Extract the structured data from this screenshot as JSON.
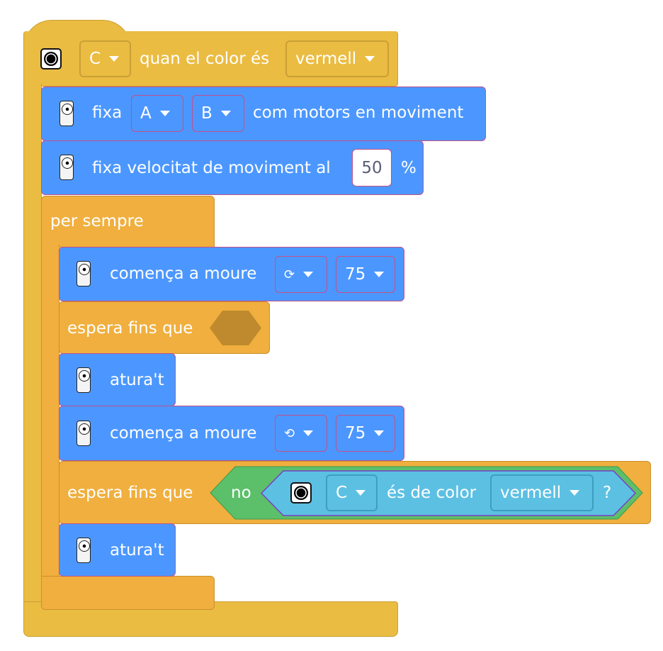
{
  "hat": {
    "port": "C",
    "label": "quan el color és",
    "color": "vermell"
  },
  "blocks": {
    "set_motors": {
      "prefix": "fixa",
      "port1": "A",
      "port2": "B",
      "suffix": "com motors en moviment"
    },
    "set_speed": {
      "label": "fixa velocitat de moviment al",
      "value": "50",
      "unit": "%"
    },
    "forever": {
      "label": "per sempre"
    },
    "start1": {
      "label": "comença a moure",
      "direction_icon": "clockwise-icon",
      "speed": "75"
    },
    "wait1": {
      "label": "espera fins que"
    },
    "stop1": {
      "label": "atura't"
    },
    "start2": {
      "label": "comença a moure",
      "direction_icon": "counterclockwise-icon",
      "speed": "75"
    },
    "wait2": {
      "label": "espera fins que",
      "not": "no",
      "sensor_port": "C",
      "is_color": "és de color",
      "color": "vermell",
      "question": "?"
    },
    "stop2": {
      "label": "atura't"
    }
  },
  "colors": {
    "events": "#EBBC42",
    "motion": "#4C97FF",
    "control": "#F0AF3E",
    "operators": "#5CBF6A",
    "sensors": "#5CC0E3"
  },
  "glyphs": {
    "cw": "⟳",
    "ccw": "⟲"
  }
}
